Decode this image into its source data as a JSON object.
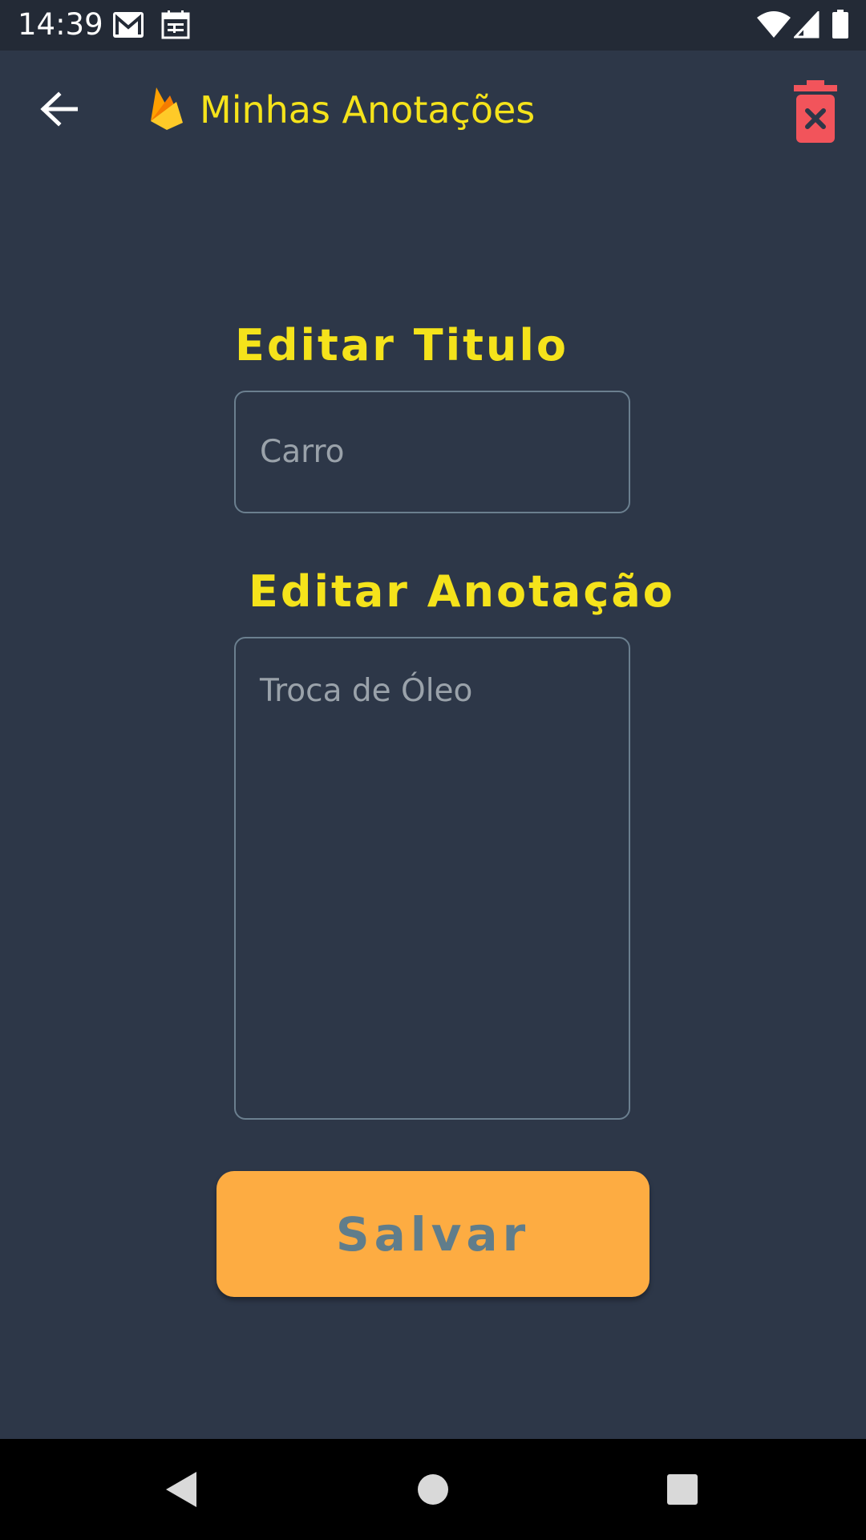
{
  "status_bar": {
    "time": "14:39",
    "icons": [
      "gmail-icon",
      "calendar-icon",
      "wifi-icon",
      "signal-icon",
      "battery-icon"
    ]
  },
  "app_bar": {
    "title": "Minhas Anotações",
    "back_icon": "arrow-back-icon",
    "logo_icon": "firebase-icon",
    "delete_icon": "trash-delete-icon"
  },
  "form": {
    "title_label": "Editar Titulo",
    "title_value": "Carro",
    "note_label": "Editar Anotação",
    "note_value": "Troca de Óleo",
    "save_label": "Salvar"
  },
  "colors": {
    "background": "#2d3748",
    "accent_yellow": "#f5e31b",
    "button_orange": "#fdac42",
    "button_text": "#607d8b",
    "delete_red": "#f2545b"
  },
  "nav_bar": {
    "buttons": [
      "back-triangle-icon",
      "home-circle-icon",
      "recents-square-icon"
    ]
  }
}
